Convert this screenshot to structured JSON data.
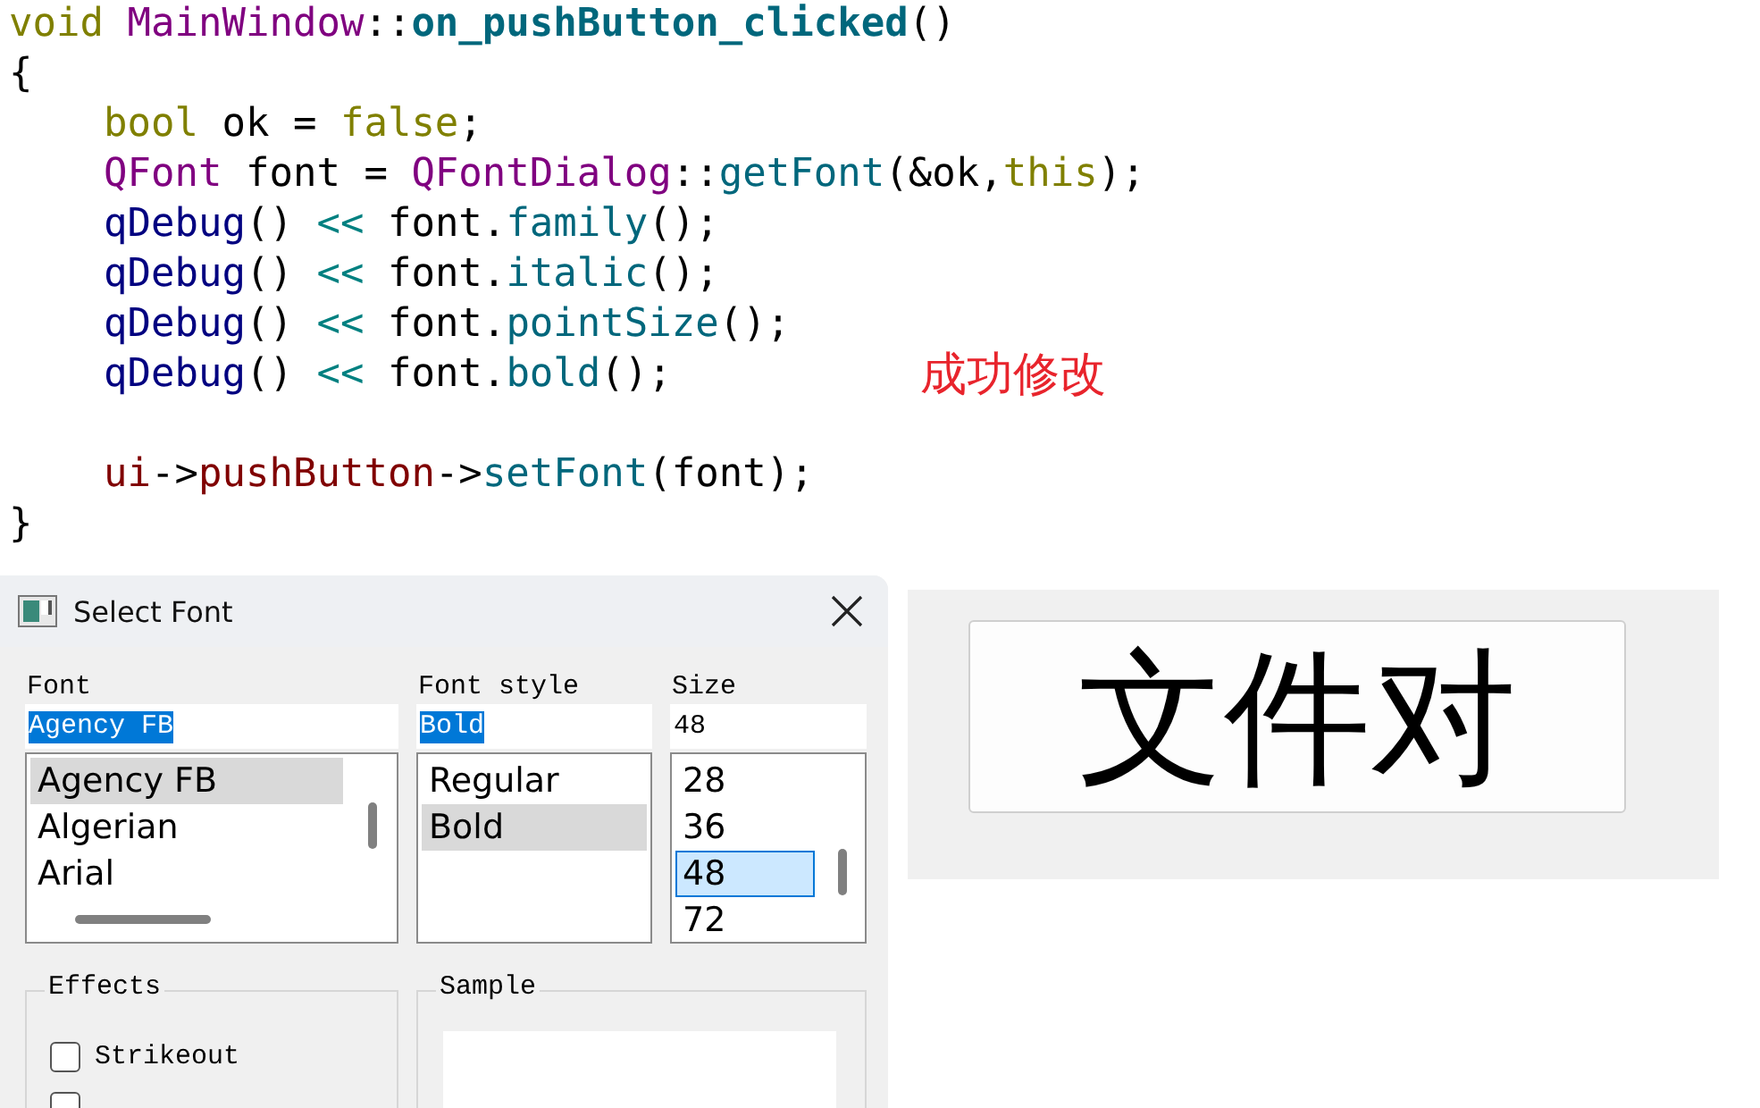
{
  "code": {
    "lines": [
      {
        "kind": "code",
        "tokens": [
          {
            "t": "void ",
            "kind": "keyword"
          },
          {
            "t": "MainWindow",
            "kind": "type"
          },
          {
            "t": "::",
            "kind": "plain"
          },
          {
            "t": "on_pushButton_clicked",
            "kind": "function_def"
          },
          {
            "t": "()",
            "kind": "plain"
          }
        ]
      },
      {
        "kind": "code",
        "tokens": [
          {
            "t": "{",
            "kind": "plain"
          }
        ]
      },
      {
        "kind": "code",
        "tokens": [
          {
            "t": "    bool",
            "kind": "keyword"
          },
          {
            "t": " ok = ",
            "kind": "plain"
          },
          {
            "t": "false",
            "kind": "keyword"
          },
          {
            "t": ";",
            "kind": "plain"
          }
        ]
      },
      {
        "kind": "code",
        "tokens": [
          {
            "t": "    QFont",
            "kind": "type"
          },
          {
            "t": " font = ",
            "kind": "plain"
          },
          {
            "t": "QFontDialog",
            "kind": "type"
          },
          {
            "t": "::",
            "kind": "plain"
          },
          {
            "t": "getFont",
            "kind": "function"
          },
          {
            "t": "(&ok,",
            "kind": "plain"
          },
          {
            "t": "this",
            "kind": "keyword"
          },
          {
            "t": ");",
            "kind": "plain"
          }
        ]
      },
      {
        "kind": "code",
        "tokens": [
          {
            "t": "    qDebug",
            "kind": "macro"
          },
          {
            "t": "() ",
            "kind": "plain"
          },
          {
            "t": "<<",
            "kind": "operator"
          },
          {
            "t": " font.",
            "kind": "plain"
          },
          {
            "t": "family",
            "kind": "function"
          },
          {
            "t": "();",
            "kind": "plain"
          }
        ]
      },
      {
        "kind": "code",
        "tokens": [
          {
            "t": "    qDebug",
            "kind": "macro"
          },
          {
            "t": "() ",
            "kind": "plain"
          },
          {
            "t": "<<",
            "kind": "operator"
          },
          {
            "t": " font.",
            "kind": "plain"
          },
          {
            "t": "italic",
            "kind": "function"
          },
          {
            "t": "();",
            "kind": "plain"
          }
        ]
      },
      {
        "kind": "code",
        "tokens": [
          {
            "t": "    qDebug",
            "kind": "macro"
          },
          {
            "t": "() ",
            "kind": "plain"
          },
          {
            "t": "<<",
            "kind": "operator"
          },
          {
            "t": " font.",
            "kind": "plain"
          },
          {
            "t": "pointSize",
            "kind": "function"
          },
          {
            "t": "();",
            "kind": "plain"
          }
        ]
      },
      {
        "kind": "code",
        "tokens": [
          {
            "t": "    qDebug",
            "kind": "macro"
          },
          {
            "t": "() ",
            "kind": "plain"
          },
          {
            "t": "<<",
            "kind": "operator"
          },
          {
            "t": " font.",
            "kind": "plain"
          },
          {
            "t": "bold",
            "kind": "function"
          },
          {
            "t": "();",
            "kind": "plain"
          }
        ]
      },
      {
        "kind": "blank"
      },
      {
        "kind": "code",
        "tokens": [
          {
            "t": "    ui",
            "kind": "member"
          },
          {
            "t": "->",
            "kind": "plain"
          },
          {
            "t": "pushButton",
            "kind": "member"
          },
          {
            "t": "->",
            "kind": "plain"
          },
          {
            "t": "setFont",
            "kind": "function"
          },
          {
            "t": "(font);",
            "kind": "plain"
          }
        ]
      },
      {
        "kind": "code",
        "tokens": [
          {
            "t": "}",
            "kind": "plain"
          }
        ]
      }
    ]
  },
  "annotation": "成功修改",
  "dialog": {
    "title": "Select Font",
    "columns": [
      {
        "label": "Font",
        "value": "Agency FB",
        "focused": false,
        "items": [
          {
            "text": "Agency FB",
            "selected": true
          },
          {
            "text": "Algerian",
            "selected": false
          },
          {
            "text": "Arial",
            "selected": false
          }
        ]
      },
      {
        "label": "Font style",
        "value": "Bold",
        "focused": false,
        "items": [
          {
            "text": "Regular",
            "selected": false
          },
          {
            "text": "Bold",
            "selected": true
          }
        ]
      },
      {
        "label": "Size",
        "value": "48",
        "focused": true,
        "items": [
          {
            "text": "28",
            "selected": false
          },
          {
            "text": "36",
            "selected": false
          },
          {
            "text": "48",
            "selected": true
          },
          {
            "text": "72",
            "selected": false
          }
        ]
      }
    ],
    "effects": {
      "title": "Effects",
      "options": [
        {
          "label": "Strikeout",
          "checked": false
        },
        {
          "checked": false
        }
      ]
    },
    "sample": {
      "title": "Sample"
    }
  },
  "preview": {
    "button_text": "文件对"
  }
}
